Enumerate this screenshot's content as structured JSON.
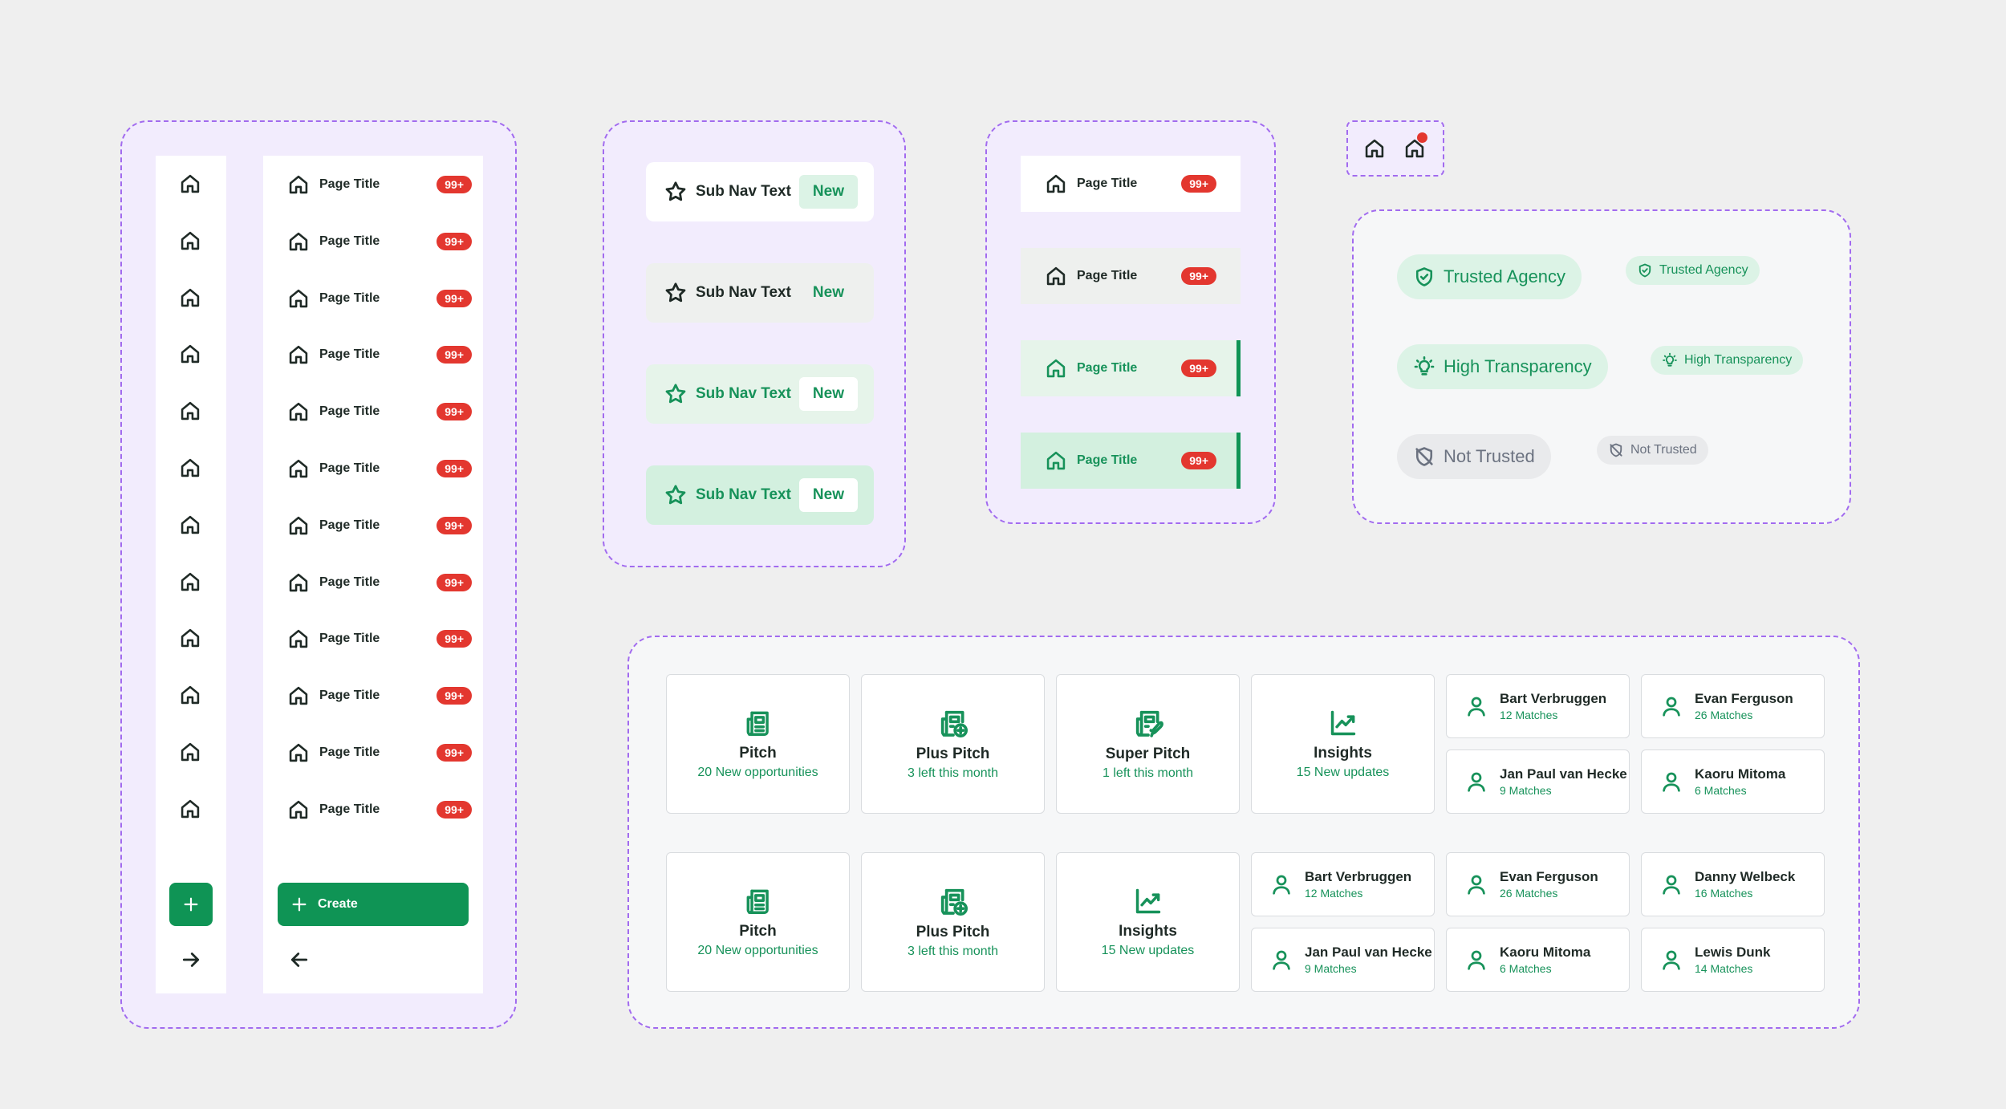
{
  "sidebar": {
    "item_label": "Page Title",
    "badge": "99+",
    "create_label": "Create",
    "rows": 12
  },
  "subnav": {
    "label": "Sub Nav Text",
    "badge": "New"
  },
  "page_title_states": {
    "label": "Page Title",
    "badge": "99+"
  },
  "trust_chips": {
    "trusted": "Trusted Agency",
    "transparency": "High Transparency",
    "not_trusted": "Not Trusted"
  },
  "cards_row1": [
    {
      "title": "Pitch",
      "sub": "20 New opportunities",
      "icon": "newspaper-icon"
    },
    {
      "title": "Plus Pitch",
      "sub": "3 left this month",
      "icon": "newspaper-plus-icon"
    },
    {
      "title": "Super Pitch",
      "sub": "1 left this month",
      "icon": "newspaper-rocket-icon"
    },
    {
      "title": "Insights",
      "sub": "15 New updates",
      "icon": "trend-chart-icon"
    }
  ],
  "cards_row2": [
    {
      "title": "Pitch",
      "sub": "20 New opportunities",
      "icon": "newspaper-icon"
    },
    {
      "title": "Plus Pitch",
      "sub": "3 left this month",
      "icon": "newspaper-plus-icon"
    },
    {
      "title": "Insights",
      "sub": "15 New updates",
      "icon": "trend-chart-icon"
    }
  ],
  "people_row1": [
    {
      "name": "Bart Verbruggen",
      "matches": "12 Matches"
    },
    {
      "name": "Evan Ferguson",
      "matches": "26 Matches"
    },
    {
      "name": "Jan Paul van Hecke",
      "matches": "9 Matches"
    },
    {
      "name": "Kaoru Mitoma",
      "matches": "6 Matches"
    }
  ],
  "people_row2": [
    {
      "name": "Bart Verbruggen",
      "matches": "12 Matches"
    },
    {
      "name": "Evan Ferguson",
      "matches": "26 Matches"
    },
    {
      "name": "Danny Welbeck",
      "matches": "16 Matches"
    },
    {
      "name": "Jan Paul van Hecke",
      "matches": "9 Matches"
    },
    {
      "name": "Kaoru Mitoma",
      "matches": "6 Matches"
    },
    {
      "name": "Lewis Dunk",
      "matches": "14 Matches"
    }
  ],
  "colors": {
    "brand_green": "#0f9455",
    "badge_red": "#e3372f",
    "frame_purple": "#a26bef",
    "frame_fill": "#f2ecfd"
  }
}
